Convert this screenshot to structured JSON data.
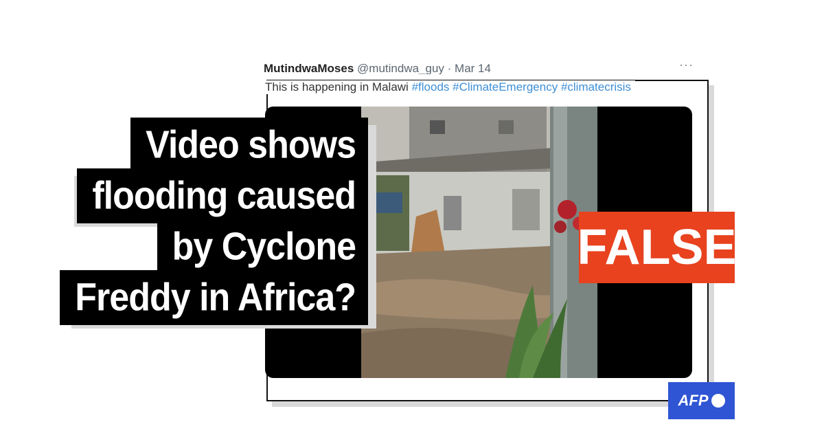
{
  "tweet": {
    "author": "MutindwaMoses",
    "handle": "@mutindwa_guy",
    "date": "· Mar 14",
    "more": "···",
    "text": "This is happening in Malawi",
    "hashtags": [
      "#floods",
      "#ClimateEmergency",
      "#climatecrisis"
    ]
  },
  "headline": {
    "lines": [
      "Video shows",
      "flooding caused",
      "by Cyclone",
      "Freddy in Africa?"
    ]
  },
  "verdict": {
    "label": "FALSE",
    "color": "#e8421f"
  },
  "brand": {
    "logo": "AFP",
    "color": "#2f55d4"
  }
}
